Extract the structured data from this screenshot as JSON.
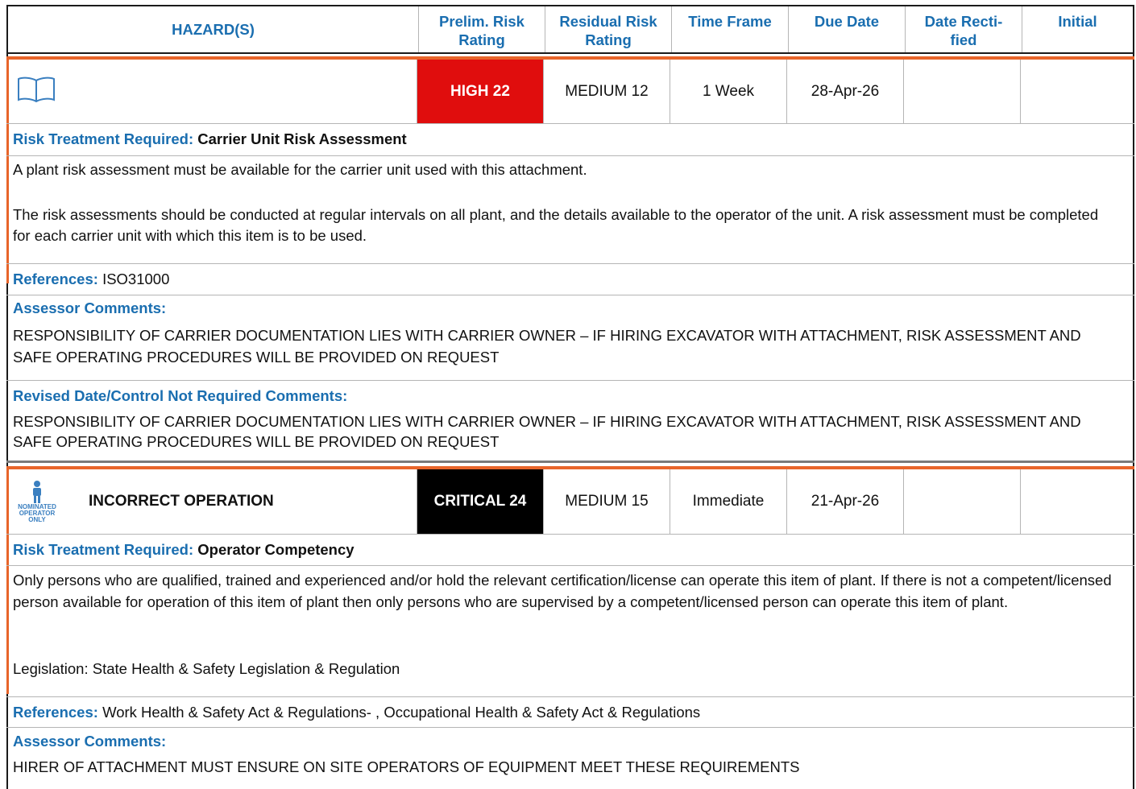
{
  "header": {
    "hazards": "HAZARD(S)",
    "prelim": "Prelim. Risk Rating",
    "residual": "Residual Risk Rating",
    "time_frame": "Time Frame",
    "due_date": "Due Date",
    "date_rectified": "Date Recti-fied",
    "initial": "Initial"
  },
  "colors": {
    "accent": "#e8652a",
    "label_blue": "#1a6eb0",
    "high": "#e00d0d",
    "critical": "#000000"
  },
  "hazards": [
    {
      "icon": "book-icon",
      "name": "",
      "prelim": "HIGH 22",
      "residual": "MEDIUM 12",
      "time_frame": "1 Week",
      "due_date": "28-Apr-26",
      "date_rectified": "",
      "initial": "",
      "treatment_label": "Risk Treatment Required:",
      "treatment": "Carrier Unit Risk Assessment",
      "desc1": "A plant risk assessment must be available for the carrier unit used with this attachment.",
      "desc2": "The risk assessments should be conducted at regular intervals on all plant, and the details available to the operator of the unit. A risk assessment must be completed for each carrier unit with which this item is to be used.",
      "references_label": "References:",
      "references": "ISO31000",
      "assessor_label": "Assessor Comments:",
      "assessor": "RESPONSIBILITY OF CARRIER DOCUMENTATION LIES WITH CARRIER OWNER – IF HIRING EXCAVATOR WITH ATTACHMENT, RISK ASSESSMENT AND SAFE OPERATING PROCEDURES WILL BE PROVIDED ON REQUEST",
      "revised_label": "Revised Date/Control Not Required Comments:",
      "revised": "RESPONSIBILITY OF CARRIER DOCUMENTATION LIES WITH CARRIER OWNER – IF HIRING EXCAVATOR WITH ATTACHMENT, RISK ASSESSMENT AND SAFE OPERATING PROCEDURES WILL BE PROVIDED ON REQUEST"
    },
    {
      "icon": "nominated-operator-icon",
      "icon_text": "NOMINATED OPERATOR ONLY",
      "name": "INCORRECT OPERATION",
      "prelim": "CRITICAL 24",
      "residual": "MEDIUM 15",
      "time_frame": "Immediate",
      "due_date": "21-Apr-26",
      "date_rectified": "",
      "initial": "",
      "treatment_label": "Risk Treatment Required:",
      "treatment": "Operator Competency",
      "desc1": "Only persons who are qualified, trained and experienced and/or hold the relevant certification/license can operate this item of plant. If there is not a competent/licensed person available for operation of this item of plant then only persons who are supervised by a competent/licensed person can operate this item of plant.",
      "desc2": "Legislation: State Health & Safety Legislation & Regulation",
      "references_label": "References:",
      "references": "Work Health & Safety Act & Regulations- , Occupational Health & Safety Act & Regulations",
      "assessor_label": "Assessor Comments:",
      "assessor": "HIRER OF ATTACHMENT MUST ENSURE ON SITE OPERATORS OF EQUIPMENT MEET THESE REQUIREMENTS"
    }
  ]
}
